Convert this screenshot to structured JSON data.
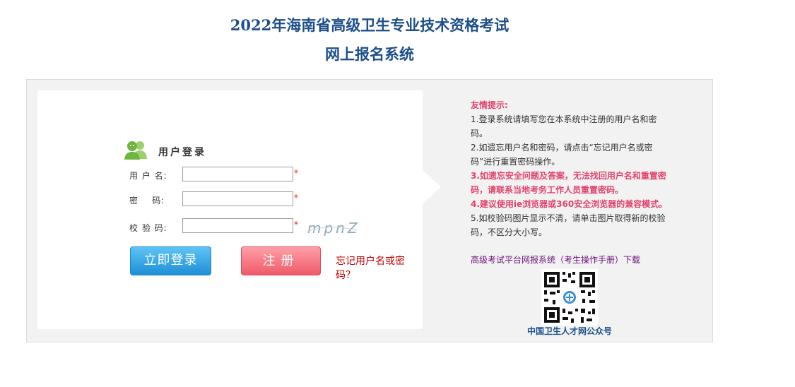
{
  "header": {
    "title_line1": "2022年海南省高级卫生专业技术资格考试",
    "title_line2": "网上报名系统"
  },
  "login": {
    "heading": "用户登录",
    "username_label": "用 户 名:",
    "password_label": "密    码:",
    "captcha_label": "校 验 码:",
    "required_mark": "*",
    "username_value": "",
    "password_value": "",
    "captcha_value": "",
    "captcha_text": "mpnZ",
    "login_button": "立即登录",
    "register_button": "注册",
    "forgot_link": "忘记用户名或密码？"
  },
  "tips": {
    "title": "友情提示:",
    "items": [
      "1.登录系统请填写您在本系统中注册的用户名和密码。",
      "2.如遗忘用户名和密码，请点击“忘记用户名或密码”进行重置密码操作。",
      "3.如遗忘安全问题及答案，无法找回用户名和重置密码，请联系当地考务工作人员重置密码。",
      "4.建议使用ie浏览器或360安全浏览器的兼容模式。",
      "5.如校验码图片显示不清，请单击图片取得新的校验码，不区分大小写。"
    ],
    "manual_link": "高级考试平台网报系统（考生操作手册）下载",
    "qr_caption": "中国卫生人才网公众号"
  },
  "colors": {
    "title": "#1d4f8a",
    "tip_red": "#e0436b",
    "login_button": "#1e8fd6",
    "register_button": "#ef5a69",
    "forgot_link": "#cc0000"
  },
  "icons": {
    "user": "user-group-icon",
    "qr": "qr-code-icon"
  }
}
